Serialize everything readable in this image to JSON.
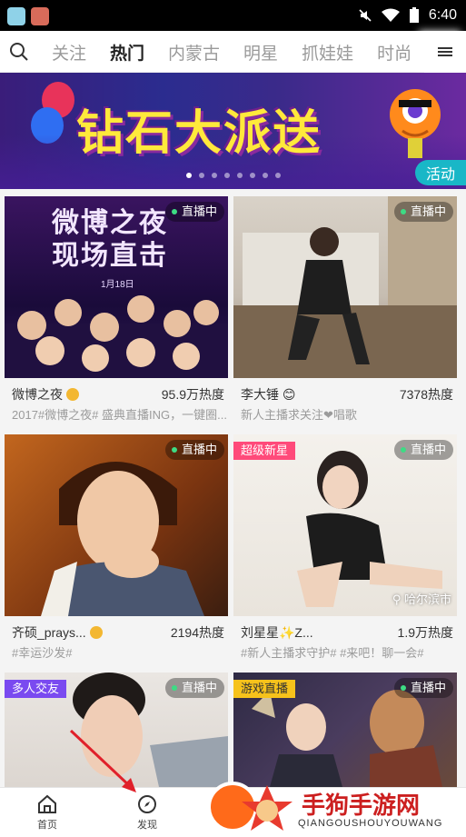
{
  "status_bar": {
    "time": "6:40"
  },
  "nav": {
    "tabs": [
      "关注",
      "热门",
      "内蒙古",
      "明星",
      "抓娃娃",
      "时尚"
    ],
    "active_index": 1
  },
  "banner": {
    "title": "钻石大派送",
    "badge": "活动",
    "dot_count": 8,
    "active_dot": 0
  },
  "cards": [
    {
      "name": "微博之夜",
      "verified": true,
      "heat": "95.9万热度",
      "desc": "2017#微博之夜# 盛典直播ING，一键圈...",
      "status": "直播中",
      "thumb_title": [
        "微博之夜",
        "现场直击"
      ],
      "thumb_date": "1月18日"
    },
    {
      "name": "李大锤",
      "verified": false,
      "emoji": "😊",
      "heat": "7378热度",
      "desc": "新人主播求关注❤唱歌",
      "status": "直播中"
    },
    {
      "name": "齐硕_prays...",
      "verified": true,
      "heat": "2194热度",
      "desc": "#幸运沙发#",
      "status": "直播中"
    },
    {
      "name": "刘星星✨Z...",
      "verified": false,
      "heat": "1.9万热度",
      "desc": "#新人主播求守护# #来吧！聊一会#",
      "status": "直播中",
      "tag": "超级新星",
      "location": "哈尔滨市"
    },
    {
      "status": "直播中",
      "tag": "多人交友"
    },
    {
      "status": "直播中",
      "tag": "游戏直播"
    }
  ],
  "bottom_nav": {
    "home": "首页",
    "discover": "发现"
  },
  "watermark": {
    "text": "手狗手游网",
    "sub": "QIANGOUSHOUYOUWANG"
  },
  "colors": {
    "accent": "#ff6a1a",
    "teal": "#19b7c7",
    "tag_pink": "#ff4a7a",
    "tag_purple": "#7a4af0",
    "tag_yellow": "#f6c21b"
  }
}
